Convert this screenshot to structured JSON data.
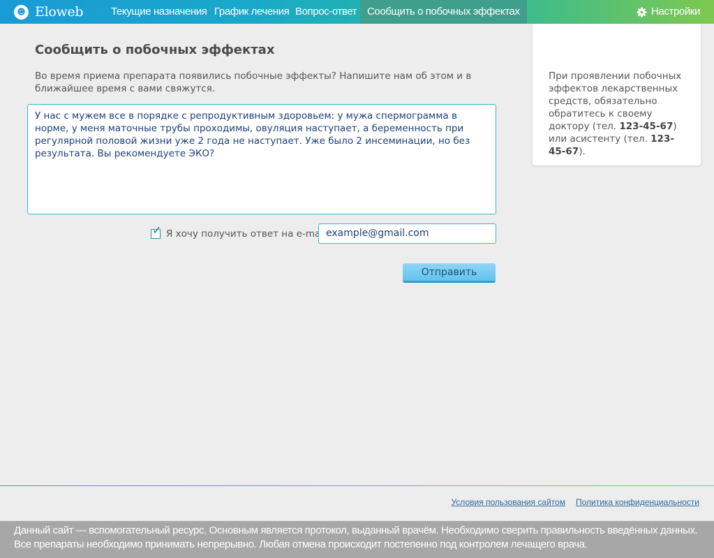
{
  "header": {
    "logo_text": "Eloweb",
    "nav": [
      {
        "label": "Текущие назначения"
      },
      {
        "label": "График лечения"
      },
      {
        "label": "Вопрос-ответ"
      },
      {
        "label": "Сообщить о побочных эффектах",
        "active": true
      }
    ],
    "settings_label": "Настройки",
    "accent_colors": [
      "#1a9ad6",
      "#28b8a0",
      "#7ec850"
    ]
  },
  "main": {
    "title": "Сообщить о побочных эффектах",
    "intro": "Во время приема препарата появились побочные эффекты? Напишите нам об этом и в ближайшее время с вами свяжутся.",
    "message_value": "У нас с мужем все в порядке с репродуктивным здоровьем: у мужа спермограмма в норме, у меня маточные трубы проходимы, овуляция наступает, а беременность при регулярной половой жизни уже 2 года не наступает. Уже было 2 инсеминации, но без результата. Вы рекомендуете ЭКО?",
    "email_checkbox_label": "Я хочу получить ответ на e-mail:",
    "email_checkbox_checked": true,
    "email_value": "example@gmail.com",
    "submit_label": "Отправить"
  },
  "info": {
    "text_1": "При проявлении побочных эффектов лекарственных средств, обязательно обратитесь к своему доктору (тел. ",
    "phone_doctor": "123-45-67",
    "text_2": ") или асистенту (тел. ",
    "phone_assistant": "123-45-67",
    "text_3": ")."
  },
  "footer": {
    "links": [
      "Условия пользования сайтом",
      "Политика конфиденциальности"
    ],
    "disclaimer": "Данный сайт — вспомогательный ресурс. Основным является протокол, выданный врачём. Необходимо сверить правильность введённых данных. Все препараты необходимо принимать непрерывно.  Любая отмена происходит постепенно под контролем лечащего врача."
  }
}
